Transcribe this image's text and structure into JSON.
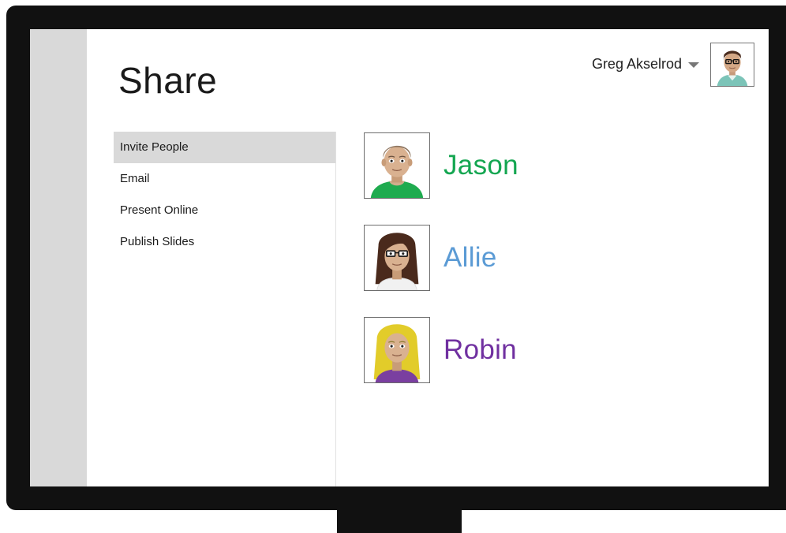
{
  "page": {
    "title": "Share"
  },
  "user": {
    "name": "Greg Akselrod",
    "avatar_icon": "man-glasses-avatar-icon"
  },
  "menu": {
    "items": [
      {
        "label": "Invite People",
        "selected": true
      },
      {
        "label": "Email",
        "selected": false
      },
      {
        "label": "Present Online",
        "selected": false
      },
      {
        "label": "Publish Slides",
        "selected": false
      }
    ]
  },
  "people": [
    {
      "name": "Jason",
      "color": "#14a651",
      "avatar_icon": "man-avatar-icon"
    },
    {
      "name": "Allie",
      "color": "#5b9bd5",
      "avatar_icon": "woman-glasses-avatar-icon"
    },
    {
      "name": "Robin",
      "color": "#7030a0",
      "avatar_icon": "blonde-woman-avatar-icon"
    }
  ],
  "colors": {
    "frame": "#111111",
    "rail": "#d9d9d9",
    "selected_item": "#d9d9d9"
  }
}
